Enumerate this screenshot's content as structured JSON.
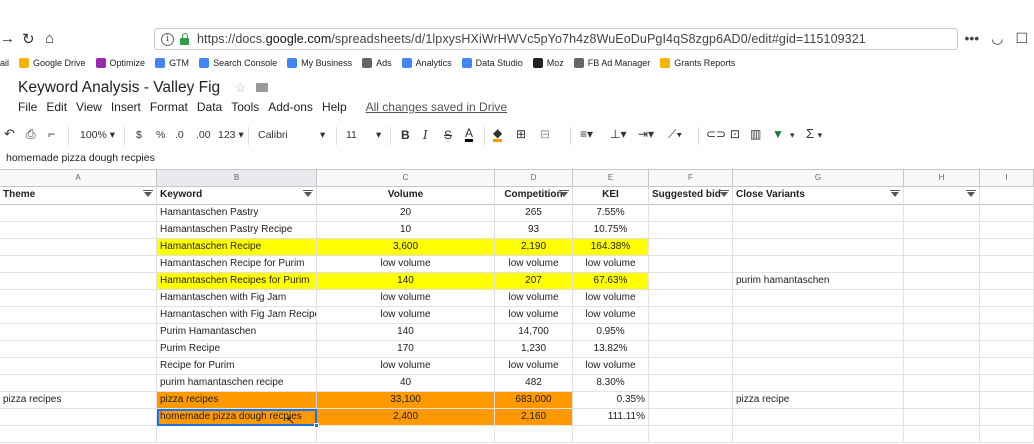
{
  "browser": {
    "url_prefix": "https://docs.",
    "url_domain": "google.com",
    "url_rest": "/spreadsheets/d/1lpxysHXiWrHWVc5pYo7h4z8WuEoDuPgI4qS8zgp6AD0/edit#gid=115109321",
    "more_icon": "•••"
  },
  "bookmarks": [
    {
      "label": "ail",
      "icon": "gmail-icon",
      "color": ""
    },
    {
      "label": "Google Drive",
      "icon": "drive-icon",
      "color": "#f4b400"
    },
    {
      "label": "Optimize",
      "icon": "optimize-icon",
      "color": "#9c27b0"
    },
    {
      "label": "GTM",
      "icon": "gtm-icon",
      "color": "#4285f4"
    },
    {
      "label": "Search Console",
      "icon": "google-icon",
      "color": "#4285f4"
    },
    {
      "label": "My Business",
      "icon": "mybusiness-icon",
      "color": "#4285f4"
    },
    {
      "label": "Ads",
      "icon": "globe-icon",
      "color": "#666666"
    },
    {
      "label": "Analytics",
      "icon": "google-icon",
      "color": "#4285f4"
    },
    {
      "label": "Data Studio",
      "icon": "datastudio-icon",
      "color": "#4285f4"
    },
    {
      "label": "Moz",
      "icon": "moz-icon",
      "color": "#222222"
    },
    {
      "label": "FB Ad Manager",
      "icon": "globe-icon",
      "color": "#666666"
    },
    {
      "label": "Grants Reports",
      "icon": "drive-icon",
      "color": "#f4b400"
    }
  ],
  "document": {
    "title": "Keyword Analysis - Valley Fig",
    "menu": [
      "File",
      "Edit",
      "View",
      "Insert",
      "Format",
      "Data",
      "Tools",
      "Add-ons",
      "Help"
    ],
    "saved_status": "All changes saved in Drive"
  },
  "toolbar": {
    "zoom": "100%",
    "currency": "$",
    "percent": "%",
    "decimal_less": ".0",
    "decimal_more": ".00",
    "format_more": "123",
    "font": "Calibri",
    "font_size": "11",
    "bold": "B",
    "italic": "I",
    "strike": "S",
    "text_color": "A",
    "sum": "Σ"
  },
  "formula_bar": {
    "value": "homemade pizza dough recpies"
  },
  "columns": [
    "A",
    "B",
    "C",
    "D",
    "E",
    "F",
    "G",
    "H",
    "I"
  ],
  "headers": [
    "Theme",
    "Keyword",
    "Volume",
    "Competition",
    "KEI",
    "Suggested bid",
    "Close Variants",
    "",
    ""
  ],
  "rows": [
    {
      "theme": "",
      "keyword": "Hamantaschen Pastry",
      "volume": "20",
      "competition": "265",
      "kei": "7.55%",
      "bid": "",
      "variant": "",
      "fill": ""
    },
    {
      "theme": "",
      "keyword": "Hamantaschen Pastry Recipe",
      "volume": "10",
      "competition": "93",
      "kei": "10.75%",
      "bid": "",
      "variant": "",
      "fill": ""
    },
    {
      "theme": "",
      "keyword": "Hamantaschen Recipe",
      "volume": "3,600",
      "competition": "2,190",
      "kei": "164.38%",
      "bid": "",
      "variant": "",
      "fill": "yellow"
    },
    {
      "theme": "",
      "keyword": "Hamantaschen Recipe for Purim",
      "volume": "low volume",
      "competition": "low volume",
      "kei": "low volume",
      "bid": "",
      "variant": "",
      "fill": ""
    },
    {
      "theme": "",
      "keyword": "Hamantaschen Recipes for Purim",
      "volume": "140",
      "competition": "207",
      "kei": "67.63%",
      "bid": "",
      "variant": "purim hamantaschen",
      "fill": "yellow"
    },
    {
      "theme": "",
      "keyword": "Hamantaschen with Fig Jam",
      "volume": "low volume",
      "competition": "low volume",
      "kei": "low volume",
      "bid": "",
      "variant": "",
      "fill": ""
    },
    {
      "theme": "",
      "keyword": "Hamantaschen with Fig Jam Recipe",
      "volume": "low volume",
      "competition": "low volume",
      "kei": "low volume",
      "bid": "",
      "variant": "",
      "fill": ""
    },
    {
      "theme": "",
      "keyword": "Purim Hamantaschen",
      "volume": "140",
      "competition": "14,700",
      "kei": "0.95%",
      "bid": "",
      "variant": "",
      "fill": ""
    },
    {
      "theme": "",
      "keyword": "Purim Recipe",
      "volume": "170",
      "competition": "1,230",
      "kei": "13.82%",
      "bid": "",
      "variant": "",
      "fill": ""
    },
    {
      "theme": "",
      "keyword": "Recipe for Purim",
      "volume": "low volume",
      "competition": "low volume",
      "kei": "low volume",
      "bid": "",
      "variant": "",
      "fill": ""
    },
    {
      "theme": "",
      "keyword": "purim hamantaschen recipe",
      "volume": "40",
      "competition": "482",
      "kei": "8.30%",
      "bid": "",
      "variant": "",
      "fill": ""
    },
    {
      "theme": "pizza recipes",
      "keyword": "pizza recipes",
      "volume": "33,100",
      "competition": "683,000",
      "kei": "0.35%",
      "bid": "",
      "variant": "pizza recipe",
      "fill": "orange"
    },
    {
      "theme": "",
      "keyword": "homemade pizza dough recpies",
      "volume": "2,400",
      "competition": "2,160",
      "kei": "111.11%",
      "bid": "",
      "variant": "",
      "fill": "orange"
    }
  ],
  "colors": {
    "yellow_fill": "#ffff00",
    "orange_fill": "#ff9900",
    "selection": "#1a73e8",
    "filter_green": "#188038"
  }
}
